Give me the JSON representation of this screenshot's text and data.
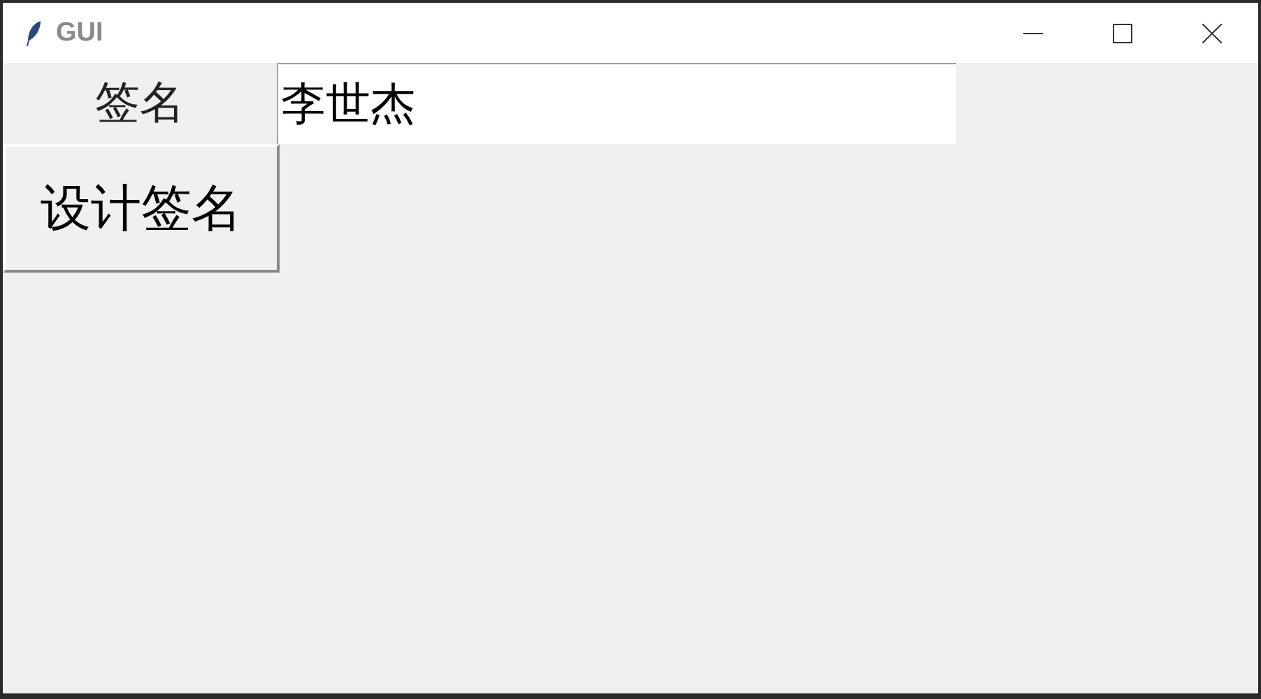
{
  "window": {
    "title": "GUI"
  },
  "form": {
    "label": "签名",
    "entry": {
      "value": "李世杰"
    },
    "button": {
      "label": "设计签名"
    }
  }
}
